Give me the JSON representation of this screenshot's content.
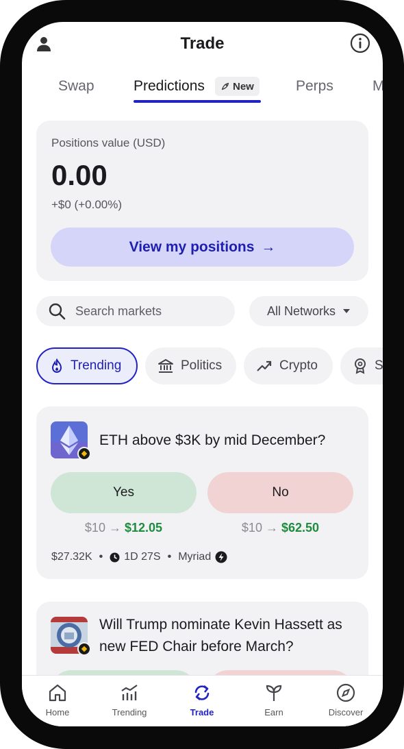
{
  "header": {
    "title": "Trade"
  },
  "tabs": {
    "items": [
      {
        "label": "Swap"
      },
      {
        "label": "Predictions",
        "badge": "New"
      },
      {
        "label": "Perps"
      },
      {
        "label": "M"
      }
    ],
    "active": "Predictions"
  },
  "positions": {
    "label": "Positions value (USD)",
    "value": "0.00",
    "change": "+$0 (+0.00%)",
    "button_label": "View my positions",
    "button_arrow": "→"
  },
  "search": {
    "placeholder": "Search markets"
  },
  "network_filter": {
    "value": "All Networks"
  },
  "categories": [
    {
      "label": "Trending",
      "icon": "flame-icon",
      "active": true
    },
    {
      "label": "Politics",
      "icon": "bank-icon",
      "active": false
    },
    {
      "label": "Crypto",
      "icon": "trend-up-icon",
      "active": false
    },
    {
      "label": "S",
      "icon": "badge-icon",
      "active": false
    }
  ],
  "markets": [
    {
      "question": "ETH above $3K by mid December?",
      "yes_label": "Yes",
      "no_label": "No",
      "yes_from": "$10",
      "yes_to": "$12.05",
      "no_from": "$10",
      "no_to": "$62.50",
      "arrow": "→",
      "volume": "$27.32K",
      "time_left": "1D 27S",
      "source": "Myriad"
    },
    {
      "question": "Will Trump nominate Kevin Hassett as new FED Chair before March?"
    }
  ],
  "bottom_nav": {
    "items": [
      {
        "label": "Home"
      },
      {
        "label": "Trending"
      },
      {
        "label": "Trade"
      },
      {
        "label": "Earn"
      },
      {
        "label": "Discover"
      }
    ],
    "active": "Trade"
  },
  "colors": {
    "accent": "#2222c4",
    "yes_bg": "#cfe6d6",
    "no_bg": "#f1d3d3",
    "gain": "#1d8c3c"
  }
}
